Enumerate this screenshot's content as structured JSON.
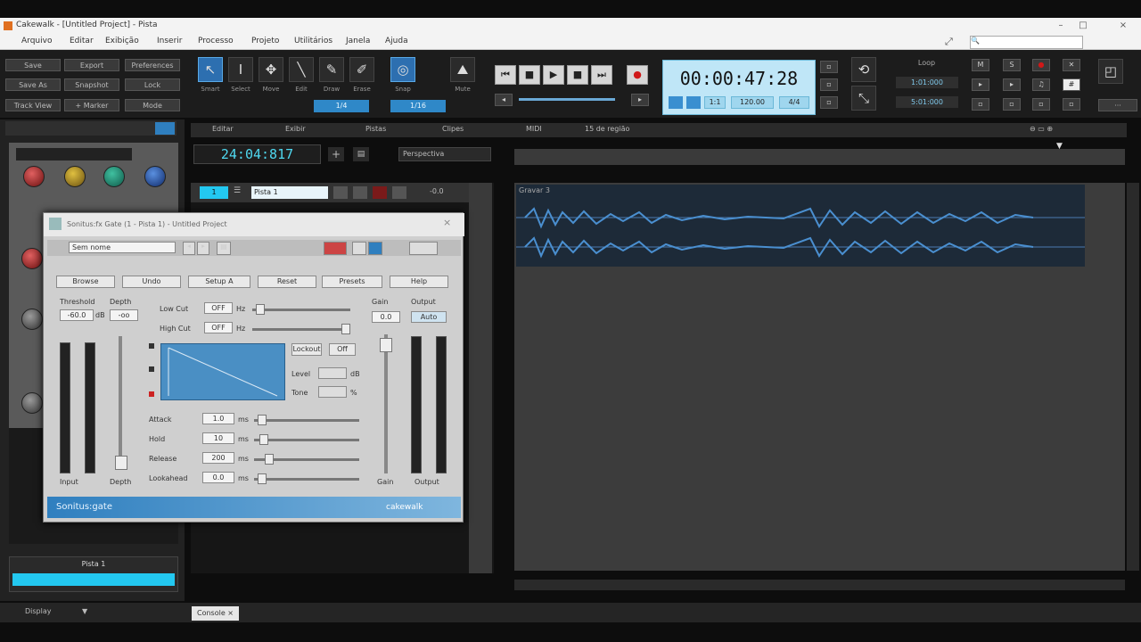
{
  "window": {
    "title": "Cakewalk - [Untitled Project] - Pista",
    "minimize": "–",
    "maximize": "□",
    "close": "×"
  },
  "menu": [
    "Arquivo",
    "Editar",
    "Exibição",
    "Inserir",
    "Processo",
    "Projeto",
    "Utilitários",
    "Janela",
    "Ajuda"
  ],
  "search": {
    "placeholder": "🔍"
  },
  "toolbar": {
    "file_buttons": [
      "Save",
      "Export",
      "Preferences",
      "Save As",
      "Snapshot",
      "Lock",
      "Track View",
      "+ Marker",
      "Mode"
    ],
    "tools": [
      {
        "icon": "↖",
        "label": "Smart"
      },
      {
        "icon": "I",
        "label": "Select"
      },
      {
        "icon": "✥",
        "label": "Move"
      },
      {
        "icon": "╲",
        "label": "Edit"
      },
      {
        "icon": "✎",
        "label": "Draw"
      },
      {
        "icon": "✐",
        "label": "Erase"
      }
    ],
    "snap_label": "Snap",
    "mute_label": "Mute",
    "snap_value": "1/16",
    "trim_value": "1/4"
  },
  "transport": {
    "time": "00:00:47:28",
    "tempo": "120.00",
    "meter": "4/4",
    "ratio": "1:1",
    "loop_label": "Loop",
    "loop_start": "1:01:000",
    "loop_end": "5:01:000",
    "rec_icons": [
      "⏮",
      "■",
      "▶",
      "■",
      "⏭",
      "●"
    ]
  },
  "header_menu": [
    "Editar",
    "Exibir",
    "Pistas",
    "Clipes",
    "MIDI",
    "15 de região"
  ],
  "timeline_display": "24:04:817",
  "view_select": "Perspectiva",
  "track": {
    "number": "1",
    "name": "Pista 1",
    "volume": "-0.0"
  },
  "clip_name": "Gravar 3",
  "plugin": {
    "title": "Sonitus:fx Gate (1 - Pista 1) - Untitled Project",
    "preset": "Sem nome",
    "buttons": [
      "Browse",
      "Undo",
      "Setup A",
      "Reset",
      "Presets",
      "Help"
    ],
    "threshold_label": "Threshold",
    "threshold_value": "-60.0",
    "depth_label": "Depth",
    "depth_value": "-oo",
    "lowcut_label": "Low Cut",
    "lowcut_value": "OFF",
    "highcut_label": "High Cut",
    "highcut_value": "OFF",
    "hz": "Hz",
    "db": "dB",
    "gain_label": "Gain",
    "gain_value": "0.0",
    "output_label": "Output",
    "output_value": "Auto",
    "sidechain_label": "Lockout",
    "off_label": "Off",
    "level_label": "Level",
    "level_unit": "dB",
    "tone_label": "Tone",
    "tone_unit": "%",
    "attack_label": "Attack",
    "attack_value": "1.0",
    "hold_label": "Hold",
    "hold_value": "10",
    "release_label": "Release",
    "release_value": "200",
    "lookahead_label": "Lookahead",
    "lookahead_value": "0.0",
    "ms": "ms",
    "input_label": "Input",
    "depth_meter_label": "Depth",
    "gain_meter_label": "Gain",
    "output_meter_label": "Output",
    "footer_left": "Sonitus:gate",
    "footer_right": "cakewalk"
  },
  "left_panel": {
    "strip_name": "Pista 1",
    "console_tab": "Console"
  },
  "statusbar": {
    "display_tab": "Display",
    "console_tab": "Console"
  }
}
